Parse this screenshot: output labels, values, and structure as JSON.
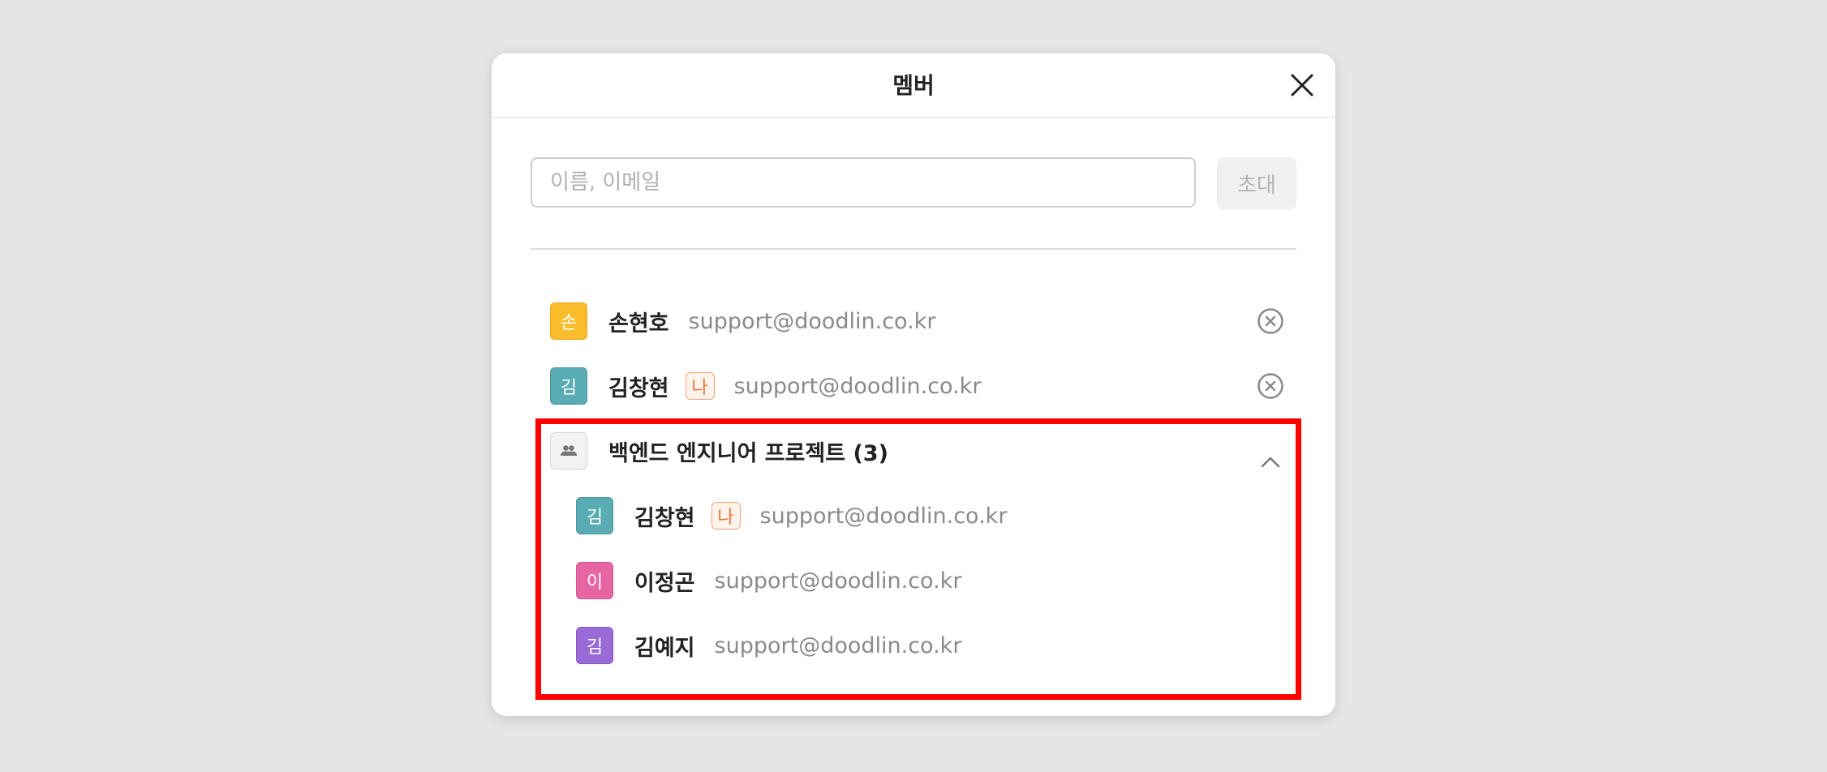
{
  "modal": {
    "title": "멤버",
    "search_placeholder": "이름, 이메일",
    "invite_label": "초대"
  },
  "members": [
    {
      "initial": "손",
      "name": "손현호",
      "email": "support@doodlin.co.kr",
      "avatar_color": "#fbbc2c",
      "is_me": false
    },
    {
      "initial": "김",
      "name": "김창현",
      "email": "support@doodlin.co.kr",
      "avatar_color": "#5aacb4",
      "is_me": true,
      "me_label": "나"
    }
  ],
  "group": {
    "name": "백엔드 엔지니어 프로젝트 (3)",
    "expanded": true,
    "members": [
      {
        "initial": "김",
        "name": "김창현",
        "email": "support@doodlin.co.kr",
        "avatar_color": "#5aacb4",
        "is_me": true,
        "me_label": "나"
      },
      {
        "initial": "이",
        "name": "이정곤",
        "email": "support@doodlin.co.kr",
        "avatar_color": "#e666a4",
        "is_me": false
      },
      {
        "initial": "김",
        "name": "김예지",
        "email": "support@doodlin.co.kr",
        "avatar_color": "#9a6ad6",
        "is_me": false
      }
    ]
  },
  "colors": {
    "highlight": "#ff0000",
    "me_badge_text": "#ee7338",
    "me_badge_border": "#f2a57f"
  }
}
